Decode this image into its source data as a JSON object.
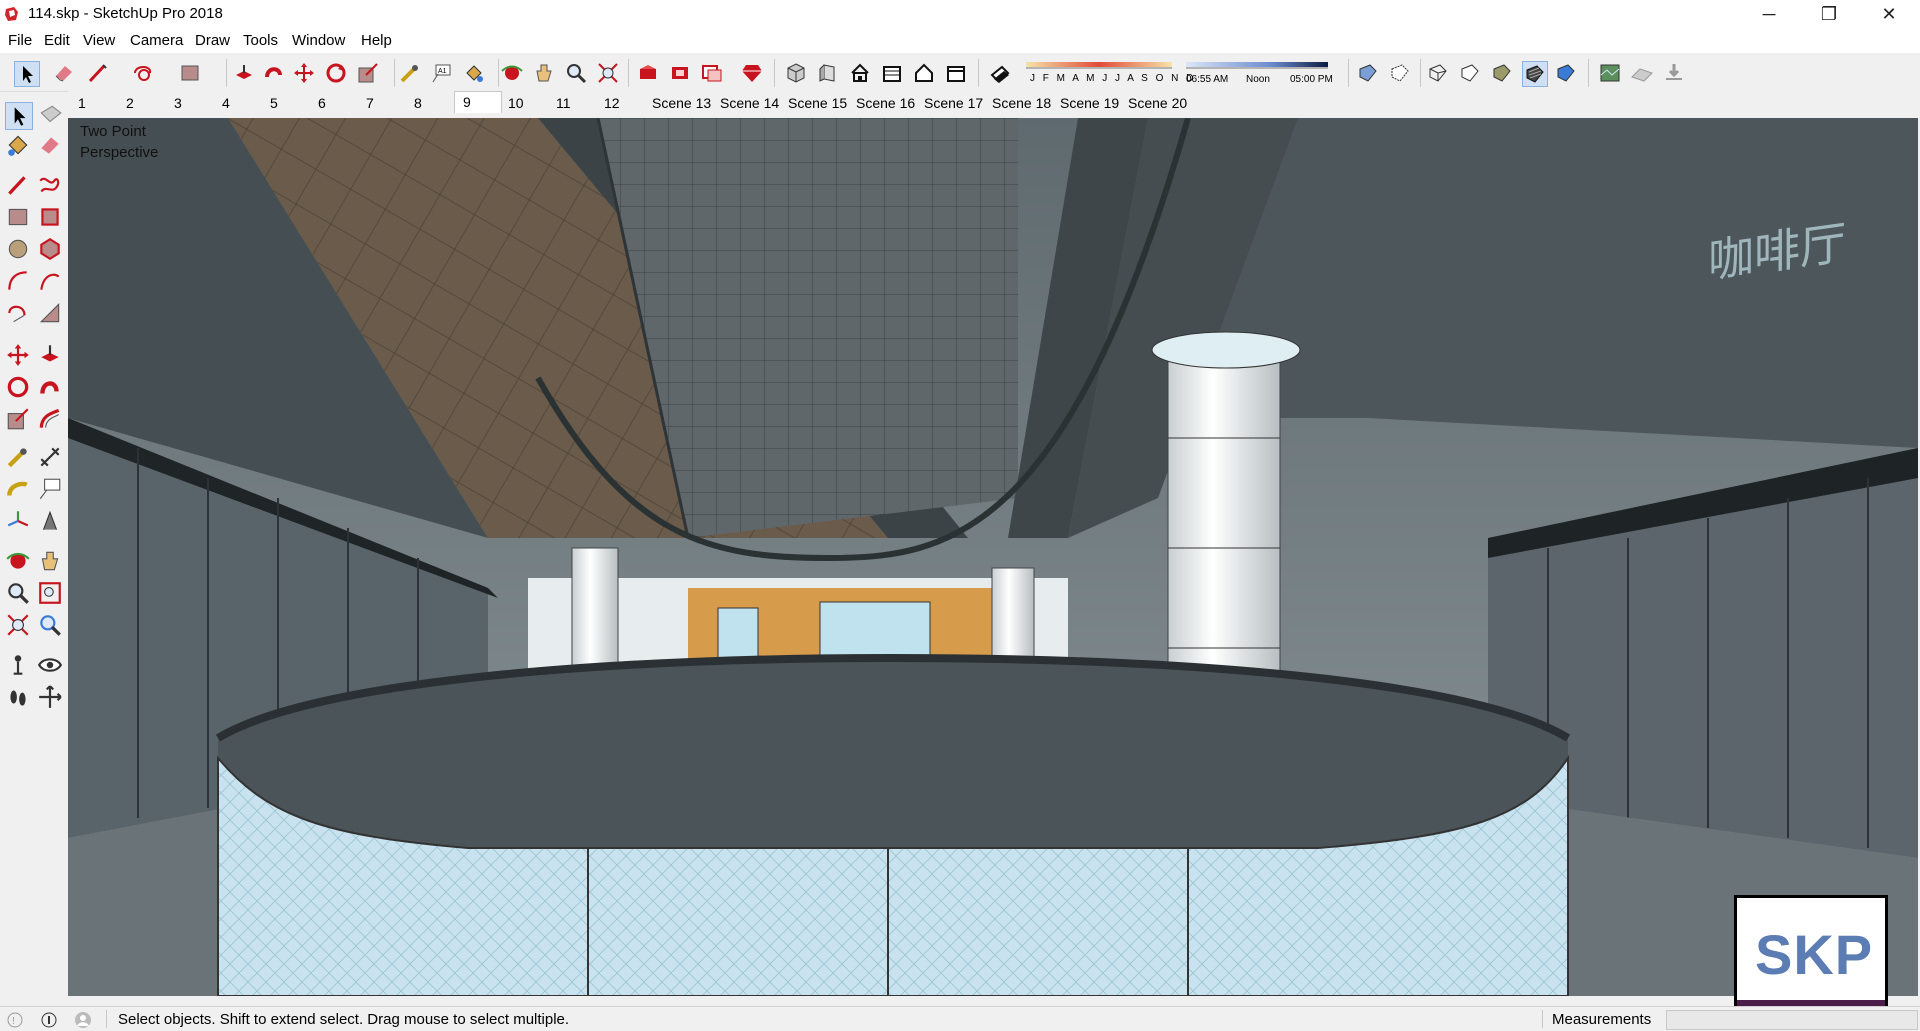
{
  "window": {
    "title": "114.skp - SketchUp Pro 2018",
    "minimize": "─",
    "restore": "❐",
    "close": "✕"
  },
  "menu": [
    "File",
    "Edit",
    "View",
    "Camera",
    "Draw",
    "Tools",
    "Window",
    "Help"
  ],
  "toolbar": {
    "icons": [
      "select-icon",
      "eraser-icon",
      "line-icon",
      "shape-icon",
      "rectangle-icon",
      "push-pull-icon",
      "follow-me-icon",
      "move-icon",
      "rotate-icon",
      "scale-icon",
      "tape-measure-icon",
      "text-icon",
      "paint-bucket-icon",
      "orbit-icon",
      "pan-icon",
      "zoom-icon",
      "zoom-extents-icon",
      "3d-warehouse-icon",
      "extension-warehouse-icon",
      "layout-icon",
      "ruby-icon",
      "iso-view-icon",
      "top-view-icon",
      "front-view-icon",
      "right-view-icon",
      "back-view-icon",
      "left-view-icon",
      "shadows-toggle-icon"
    ],
    "shadow_months": "J F M A M J J A S O N D",
    "shadow_times": {
      "start": "06:55 AM",
      "mid": "Noon",
      "end": "05:00 PM"
    },
    "style_icons": [
      "xray-icon",
      "back-edges-icon",
      "wireframe-icon",
      "hidden-line-icon",
      "shaded-icon",
      "shaded-textures-icon",
      "monochrome-icon",
      "photo-textures-icon",
      "sandbox-icon",
      "sandbox-drape-icon"
    ]
  },
  "scene_tabs": [
    "1",
    "2",
    "3",
    "4",
    "5",
    "6",
    "7",
    "8",
    "9",
    "10",
    "11",
    "12",
    "Scene 13",
    "Scene 14",
    "Scene 15",
    "Scene 16",
    "Scene 17",
    "Scene 18",
    "Scene 19",
    "Scene 20"
  ],
  "active_tab": "9",
  "viewport": {
    "camera_label_line1": "Two Point",
    "camera_label_line2": "Perspective",
    "watermark": "SKP",
    "signage": "咖啡厅"
  },
  "status": {
    "message": "Select objects. Shift to extend select. Drag mouse to select multiple.",
    "measurements_label": "Measurements",
    "measurements_value": ""
  }
}
